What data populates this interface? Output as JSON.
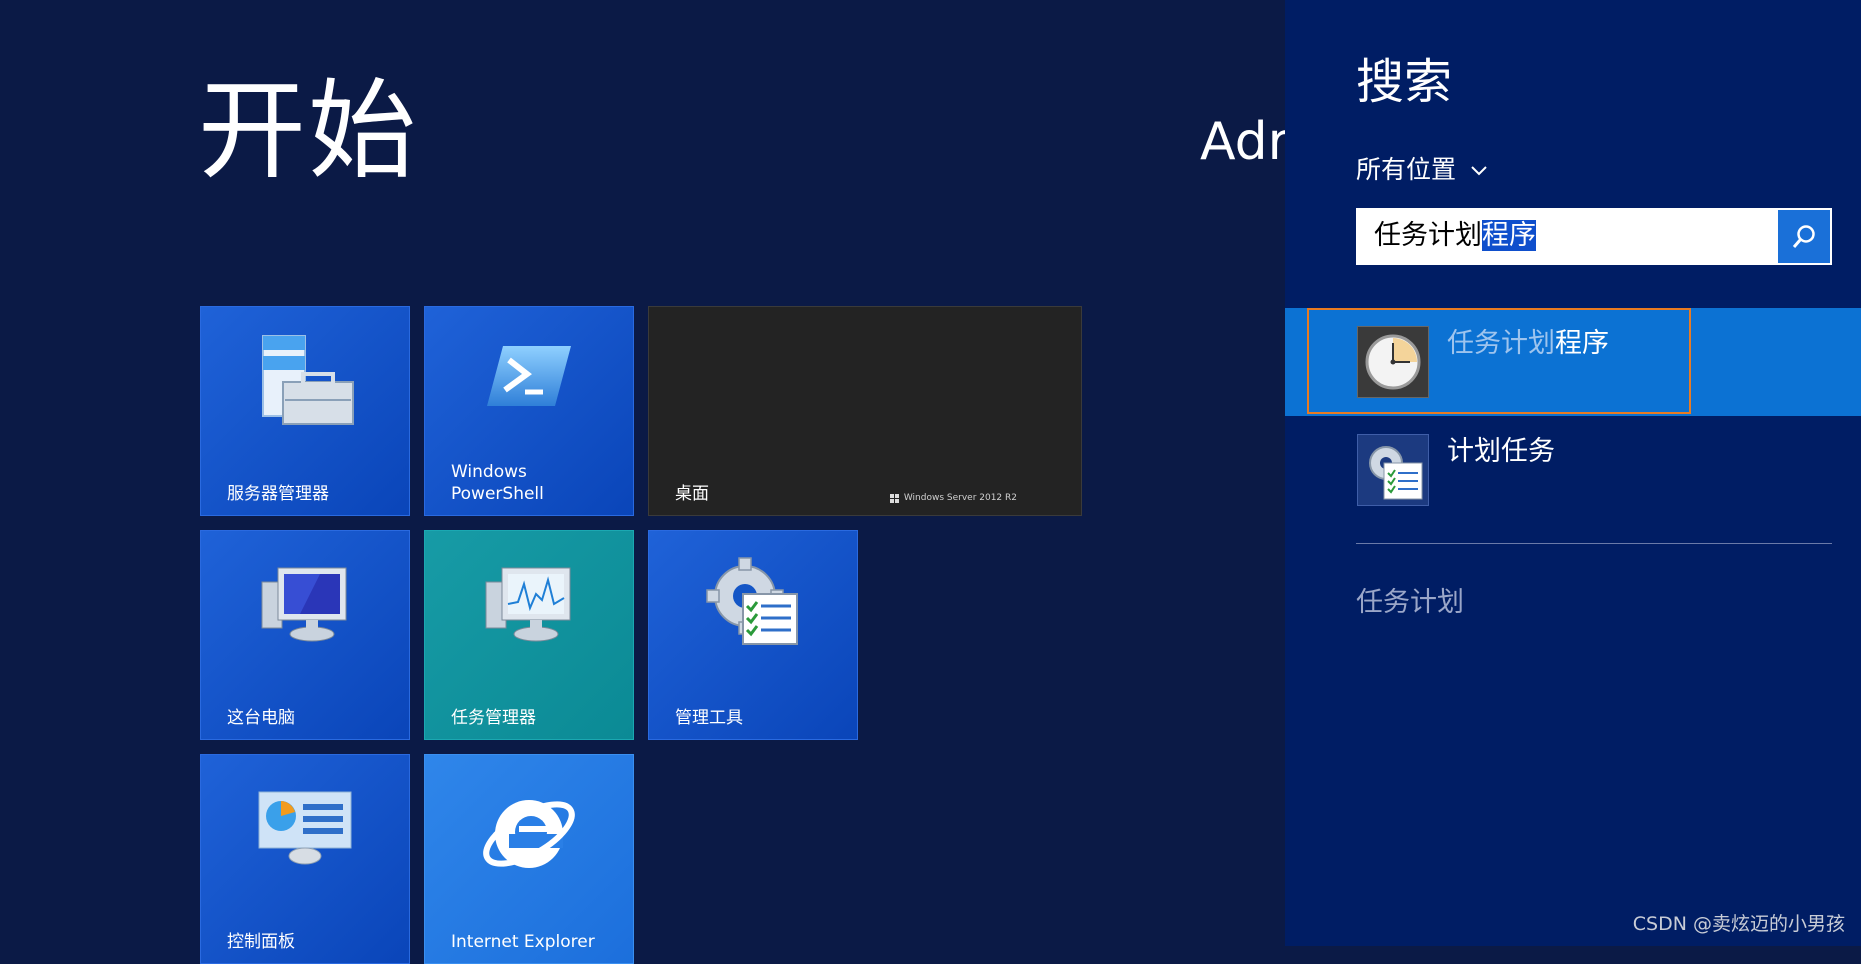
{
  "start": {
    "title": "开始",
    "user": "Adr"
  },
  "tiles": [
    {
      "label": "服务器管理器"
    },
    {
      "label": "Windows\nPowerShell"
    },
    {
      "label": "桌面",
      "brand": "Windows Server 2012 R2"
    },
    {
      "label": "这台电脑"
    },
    {
      "label": "任务管理器"
    },
    {
      "label": "管理工具"
    },
    {
      "label": "控制面板"
    },
    {
      "label": "Internet Explorer"
    }
  ],
  "search": {
    "title": "搜索",
    "scope": "所有位置",
    "query_prefix": "任务计划",
    "query_selected": "程序",
    "results": [
      {
        "dim": "任务计划",
        "bold": "程序",
        "icon": "clock-icon"
      },
      {
        "text": "计划任务",
        "icon": "gear-checklist-icon"
      }
    ],
    "category": "任务计划"
  },
  "watermark": "CSDN @卖炫迈的小男孩"
}
